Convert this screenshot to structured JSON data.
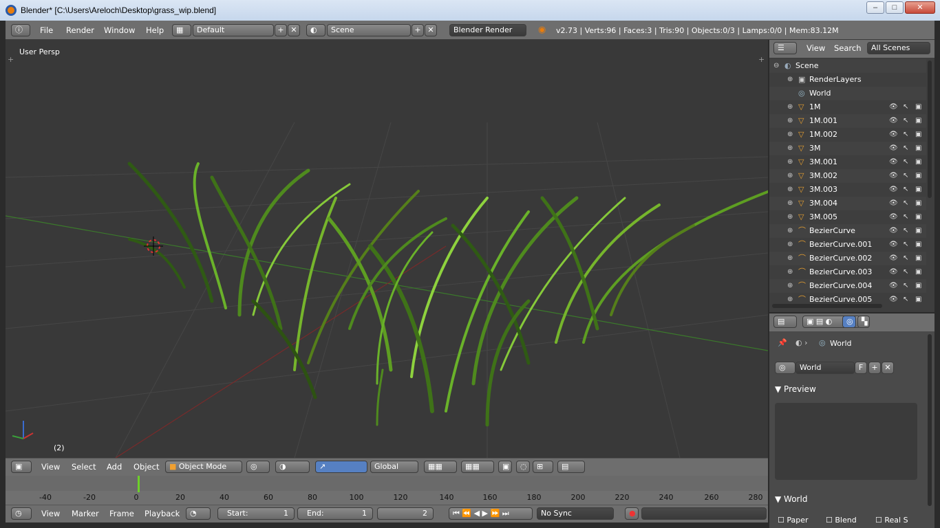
{
  "window": {
    "title": "Blender* [C:\\Users\\Areloch\\Desktop\\grass_wip.blend]"
  },
  "topbar": {
    "menus": [
      "File",
      "Render",
      "Window",
      "Help"
    ],
    "layout": "Default",
    "scene": "Scene",
    "engine": "Blender Render",
    "stats": "v2.73 | Verts:96 | Faces:3 | Tris:90 | Objects:0/3 | Lamps:0/0 | Mem:83.12M"
  },
  "viewport": {
    "label": "User Persp",
    "frame": "(2)"
  },
  "view3d_header": {
    "menus": [
      "View",
      "Select",
      "Add",
      "Object"
    ],
    "mode": "Object Mode",
    "orientation": "Global"
  },
  "timeline": {
    "ticks": [
      "-40",
      "-20",
      "0",
      "20",
      "40",
      "60",
      "80",
      "100",
      "120",
      "140",
      "160",
      "180",
      "200",
      "220",
      "240",
      "260",
      "280"
    ],
    "menus": [
      "View",
      "Marker",
      "Frame",
      "Playback"
    ],
    "start_label": "Start:",
    "start": "1",
    "end_label": "End:",
    "end": "1",
    "current": "2",
    "sync": "No Sync"
  },
  "outliner": {
    "menus": [
      "View",
      "Search"
    ],
    "filter": "All Scenes",
    "rows": [
      {
        "name": "Scene",
        "type": "scene"
      },
      {
        "name": "RenderLayers",
        "type": "layers"
      },
      {
        "name": "World",
        "type": "world"
      },
      {
        "name": "1M",
        "type": "mesh"
      },
      {
        "name": "1M.001",
        "type": "mesh"
      },
      {
        "name": "1M.002",
        "type": "mesh"
      },
      {
        "name": "3M",
        "type": "mesh"
      },
      {
        "name": "3M.001",
        "type": "mesh"
      },
      {
        "name": "3M.002",
        "type": "mesh"
      },
      {
        "name": "3M.003",
        "type": "mesh"
      },
      {
        "name": "3M.004",
        "type": "mesh"
      },
      {
        "name": "3M.005",
        "type": "mesh"
      },
      {
        "name": "BezierCurve",
        "type": "curve"
      },
      {
        "name": "BezierCurve.001",
        "type": "curve"
      },
      {
        "name": "BezierCurve.002",
        "type": "curve"
      },
      {
        "name": "BezierCurve.003",
        "type": "curve"
      },
      {
        "name": "BezierCurve.004",
        "type": "curve"
      },
      {
        "name": "BezierCurve.005",
        "type": "curve"
      }
    ]
  },
  "properties": {
    "breadcrumb": "World",
    "world_name": "World",
    "fake_user": "F",
    "panels": [
      "Preview",
      "World"
    ],
    "checkboxes": [
      "Paper",
      "Blend",
      "Real S"
    ]
  },
  "colors": {
    "accent": "#5680c2",
    "bg": "#393939",
    "grass": "#5fa21f",
    "x_axis": "#a02a2a",
    "y_axis": "#3aa03a"
  }
}
